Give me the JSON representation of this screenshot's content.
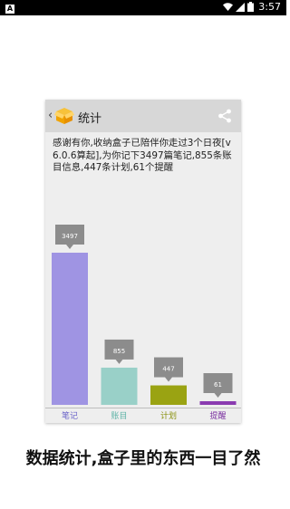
{
  "status_bar": {
    "notification": "A",
    "time": "3:57"
  },
  "app_bar": {
    "back": "‹",
    "title": "统计",
    "share_icon": "share-icon"
  },
  "summary": "感谢有你,收纳盒子已陪伴你走过3个日夜[v6.0.6算起],为你记下3497篇笔记,855条账目信息,447条计划,61个提醒",
  "chart_data": {
    "type": "bar",
    "categories": [
      "笔记",
      "账目",
      "计划",
      "提醒"
    ],
    "values": [
      3497,
      855,
      447,
      61
    ],
    "value_labels": [
      "3497",
      "855",
      "447",
      "61"
    ],
    "colors": [
      "#9f94e3",
      "#99d0c8",
      "#9aa312",
      "#8a3bb0"
    ],
    "label_colors": [
      "#6a63c9",
      "#5eb3a7",
      "#8a9210",
      "#7a2fa0"
    ],
    "title": "",
    "xlabel": "",
    "ylabel": "",
    "ylim": [
      0,
      3497
    ]
  },
  "caption": "数据统计,盒子里的东西一目了然"
}
